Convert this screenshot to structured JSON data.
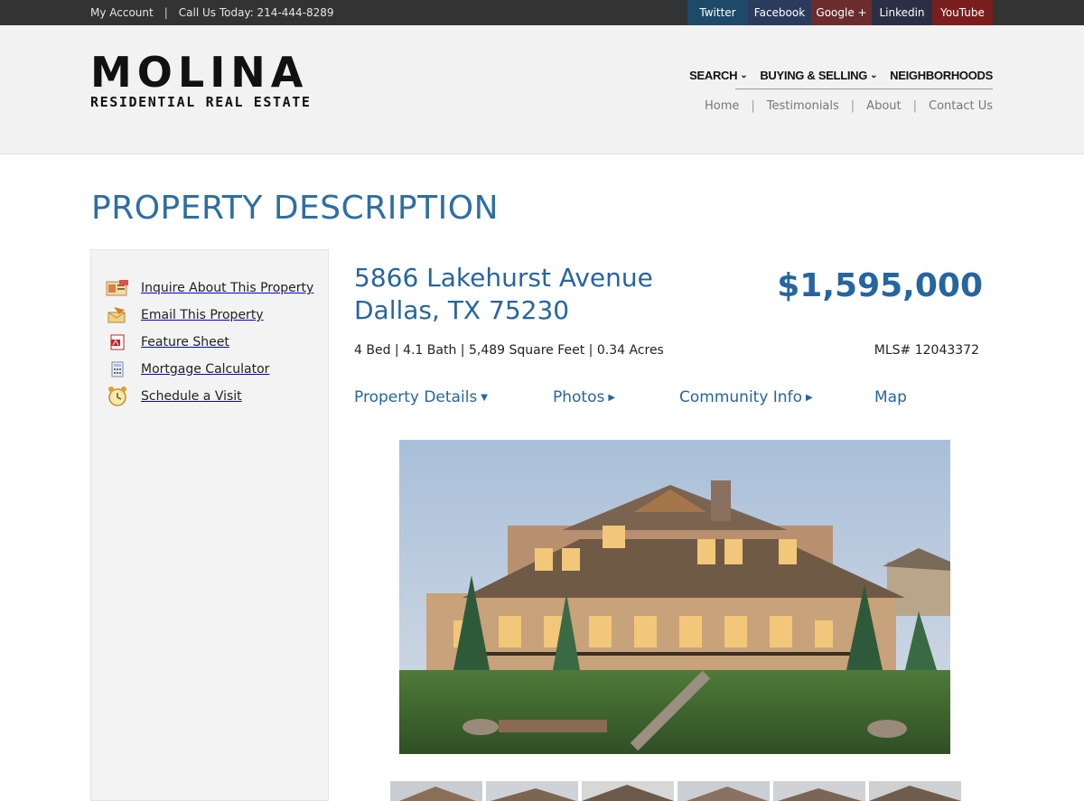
{
  "topbar": {
    "account_label": "My Account",
    "separator": "|",
    "call_label": "Call Us Today: 214-444-8289",
    "social": [
      "Twitter",
      "Facebook",
      "Google +",
      "Linkedin",
      "YouTube"
    ]
  },
  "logo": {
    "main": "MOLINA",
    "sub": "RESIDENTIAL REAL ESTATE"
  },
  "mainnav": {
    "items": [
      "SEARCH",
      "BUYING & SELLING",
      "NEIGHBORHOODS"
    ]
  },
  "subnav": {
    "items": [
      "Home",
      "Testimonials",
      "About",
      "Contact Us"
    ],
    "separator": "|"
  },
  "page_title": "PROPERTY DESCRIPTION",
  "sidebar": {
    "items": [
      {
        "label": "Inquire About This Property",
        "icon": "inquire-icon"
      },
      {
        "label": "Email This Property",
        "icon": "email-icon"
      },
      {
        "label": "Feature Sheet",
        "icon": "pdf-icon"
      },
      {
        "label": "Mortgage Calculator",
        "icon": "calculator-icon"
      },
      {
        "label": "Schedule a Visit",
        "icon": "alarm-clock-icon"
      }
    ]
  },
  "property": {
    "address_line1": "5866 Lakehurst Avenue",
    "address_line2": "Dallas, TX 75230",
    "price": "$1,595,000",
    "facts": "4 Bed | 4.1 Bath | 5,489 Square Feet | 0.34 Acres",
    "mls": "MLS# 12043372"
  },
  "tabs": {
    "items": [
      "Property Details",
      "Photos",
      "Community Info",
      "Map"
    ]
  },
  "colors": {
    "accent_blue": "#2665a0",
    "topbar": "#333333",
    "header_bg": "#f2f2f2"
  }
}
